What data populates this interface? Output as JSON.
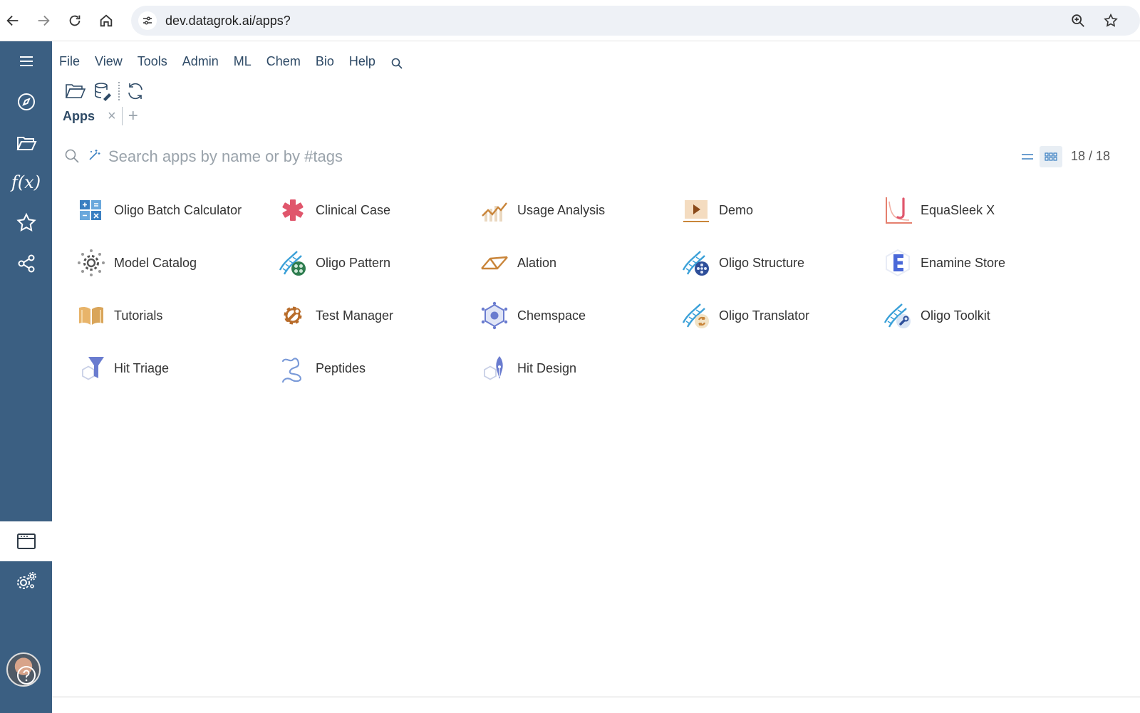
{
  "browser": {
    "url": "dev.datagrok.ai/apps?"
  },
  "menu": {
    "items": [
      "File",
      "View",
      "Tools",
      "Admin",
      "ML",
      "Chem",
      "Bio",
      "Help"
    ]
  },
  "tab": {
    "label": "Apps",
    "close": "×",
    "add": "+"
  },
  "search": {
    "placeholder": "Search apps by name or by #tags",
    "count": "18 / 18"
  },
  "sidebar": {
    "fx_label": "f(x)"
  },
  "apps": [
    {
      "label": "Oligo Batch Calculator",
      "icon": "calculator-icon",
      "color": "#3a7fc1"
    },
    {
      "label": "Clinical Case",
      "icon": "asterisk-icon",
      "color": "#e0566c"
    },
    {
      "label": "Usage Analysis",
      "icon": "usage-chart-icon",
      "color": "#c9853a"
    },
    {
      "label": "Demo",
      "icon": "play-icon",
      "color": "#c9853a"
    },
    {
      "label": "EquaSleek X",
      "icon": "curve-icon",
      "color": "#e57f6e"
    },
    {
      "label": "Model Catalog",
      "icon": "gear-dots-icon",
      "color": "#555555"
    },
    {
      "label": "Oligo Pattern",
      "icon": "dna-pattern-icon",
      "color": "#3aa0d8"
    },
    {
      "label": "Alation",
      "icon": "alation-icon",
      "color": "#c9853a"
    },
    {
      "label": "Oligo Structure",
      "icon": "dna-structure-icon",
      "color": "#3aa0d8"
    },
    {
      "label": "Enamine Store",
      "icon": "enamine-icon",
      "color": "#4a68d8"
    },
    {
      "label": "Tutorials",
      "icon": "book-icon",
      "color": "#d9a55a"
    },
    {
      "label": "Test Manager",
      "icon": "wrench-gear-icon",
      "color": "#b86c2a"
    },
    {
      "label": "Chemspace",
      "icon": "chemspace-icon",
      "color": "#6a7ccf"
    },
    {
      "label": "Oligo Translator",
      "icon": "dna-translator-icon",
      "color": "#3aa0d8"
    },
    {
      "label": "Oligo Toolkit",
      "icon": "dna-toolkit-icon",
      "color": "#3aa0d8"
    },
    {
      "label": "Hit Triage",
      "icon": "funnel-icon",
      "color": "#6a7ccf"
    },
    {
      "label": "Peptides",
      "icon": "peptide-icon",
      "color": "#7a9ad8"
    },
    {
      "label": "Hit Design",
      "icon": "pen-nib-icon",
      "color": "#6a7ccf"
    }
  ]
}
